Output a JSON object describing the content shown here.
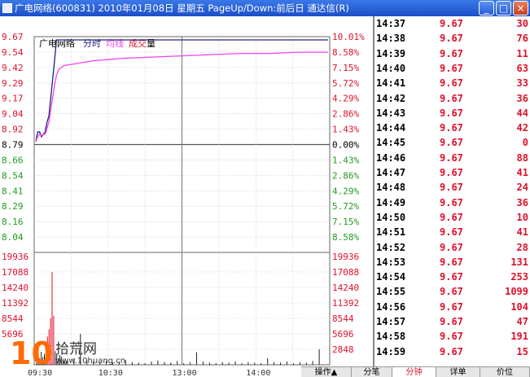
{
  "window": {
    "title": "广电网络(600831)  2010年01月08日  星期五  PageUp/Down:前后日  通达信(R)",
    "minimize": "_",
    "restore": "□",
    "close": "×"
  },
  "legend": {
    "stock_name": "广电网络",
    "intraday": "分时",
    "avg": "均线",
    "volume_label": "成交",
    "volume_unit": "量"
  },
  "colors": {
    "price": "#1a237e",
    "avg": "#ee44ee",
    "up": "#e0102a",
    "down": "#1e9c1e",
    "grid": "#999999",
    "base": "#555555"
  },
  "price_axis": {
    "left": [
      "9.67",
      "9.54",
      "9.42",
      "9.29",
      "9.17",
      "9.04",
      "8.92",
      "8.79",
      "8.66",
      "8.54",
      "8.41",
      "8.29",
      "8.16",
      "8.04"
    ],
    "right": [
      "10.01%",
      "8.58%",
      "7.15%",
      "5.72%",
      "4.29%",
      "2.86%",
      "1.43%",
      "0.00%",
      "1.43%",
      "2.86%",
      "4.29%",
      "5.72%",
      "7.15%",
      "8.58%"
    ]
  },
  "volume_axis": {
    "left": [
      "19936",
      "17088",
      "14240",
      "11392",
      "8544",
      "5696"
    ],
    "right": [
      "19936",
      "17088",
      "14240",
      "11392",
      "8544",
      "5696",
      "2848"
    ]
  },
  "time_axis": [
    "09:30",
    "10:30",
    "13:00",
    "14:00"
  ],
  "chart_data": {
    "type": "line",
    "title": "广电网络(600831) 2010年01月08日",
    "xlabel": "",
    "ylabel": "",
    "ylim": [
      7.91,
      9.67
    ],
    "x": [
      "09:30",
      "09:32",
      "09:34",
      "09:36",
      "09:38",
      "09:40",
      "09:42",
      "09:44",
      "09:46",
      "09:48",
      "09:50",
      "09:52",
      "09:54",
      "09:56",
      "09:58",
      "10:00",
      "10:15",
      "10:30",
      "11:00",
      "11:30",
      "13:00",
      "13:30",
      "14:00",
      "14:30",
      "15:00"
    ],
    "series": [
      {
        "name": "price",
        "values": [
          8.84,
          8.92,
          8.92,
          8.88,
          8.9,
          8.92,
          9.0,
          9.05,
          9.2,
          9.35,
          9.5,
          9.67,
          9.67,
          9.67,
          9.67,
          9.67,
          9.67,
          9.67,
          9.67,
          9.67,
          9.67,
          9.67,
          9.67,
          9.67,
          9.67
        ]
      },
      {
        "name": "avg",
        "values": [
          8.84,
          8.88,
          8.9,
          8.89,
          8.9,
          8.9,
          8.95,
          9.0,
          9.1,
          9.2,
          9.3,
          9.38,
          9.42,
          9.44,
          9.45,
          9.46,
          9.5,
          9.52,
          9.53,
          9.54,
          9.55,
          9.56,
          9.56,
          9.57,
          9.57
        ]
      }
    ],
    "volume": {
      "ylim": [
        0,
        19936
      ],
      "values": [
        3200,
        1500,
        1200,
        2400,
        1400,
        2000,
        3500,
        5200,
        6500,
        8544,
        17088,
        9000,
        2500,
        2000,
        1200,
        1800,
        1500,
        1000,
        800,
        600,
        900,
        1200,
        5696,
        800,
        600,
        500,
        700,
        400,
        600,
        900,
        500,
        400,
        300,
        600,
        800,
        500,
        400,
        700,
        300,
        500,
        2300,
        600,
        400,
        300,
        500,
        400,
        600,
        300,
        500,
        400,
        300,
        1200,
        500,
        400,
        600,
        300,
        500,
        400,
        700,
        2848
      ]
    },
    "grid": true
  },
  "trades": [
    {
      "time": "14:37",
      "price": "9.67",
      "vol": "30"
    },
    {
      "time": "14:38",
      "price": "9.67",
      "vol": "76"
    },
    {
      "time": "14:39",
      "price": "9.67",
      "vol": "11"
    },
    {
      "time": "14:40",
      "price": "9.67",
      "vol": "63"
    },
    {
      "time": "14:41",
      "price": "9.67",
      "vol": "33"
    },
    {
      "time": "14:42",
      "price": "9.67",
      "vol": "36"
    },
    {
      "time": "14:43",
      "price": "9.67",
      "vol": "44"
    },
    {
      "time": "14:44",
      "price": "9.67",
      "vol": "42"
    },
    {
      "time": "14:45",
      "price": "9.67",
      "vol": "0"
    },
    {
      "time": "14:46",
      "price": "9.67",
      "vol": "88"
    },
    {
      "time": "14:47",
      "price": "9.67",
      "vol": "41"
    },
    {
      "time": "14:48",
      "price": "9.67",
      "vol": "24"
    },
    {
      "time": "14:49",
      "price": "9.67",
      "vol": "36"
    },
    {
      "time": "14:50",
      "price": "9.67",
      "vol": "10"
    },
    {
      "time": "14:51",
      "price": "9.67",
      "vol": "41"
    },
    {
      "time": "14:52",
      "price": "9.67",
      "vol": "28"
    },
    {
      "time": "14:53",
      "price": "9.67",
      "vol": "131"
    },
    {
      "time": "14:54",
      "price": "9.67",
      "vol": "253"
    },
    {
      "time": "14:55",
      "price": "9.67",
      "vol": "1099"
    },
    {
      "time": "14:56",
      "price": "9.67",
      "vol": "104"
    },
    {
      "time": "14:57",
      "price": "9.67",
      "vol": "47"
    },
    {
      "time": "14:58",
      "price": "9.67",
      "vol": "191"
    },
    {
      "time": "14:59",
      "price": "9.67",
      "vol": "15"
    }
  ],
  "tabs": [
    {
      "label": "操作▲",
      "active": false
    },
    {
      "label": "分笔",
      "active": false
    },
    {
      "label": "分钟",
      "active": true
    },
    {
      "label": "详单",
      "active": false
    },
    {
      "label": "价位",
      "active": false
    }
  ],
  "watermark": {
    "number": "10",
    "text": "拾荒网",
    "url": "www.10huang.cn"
  }
}
